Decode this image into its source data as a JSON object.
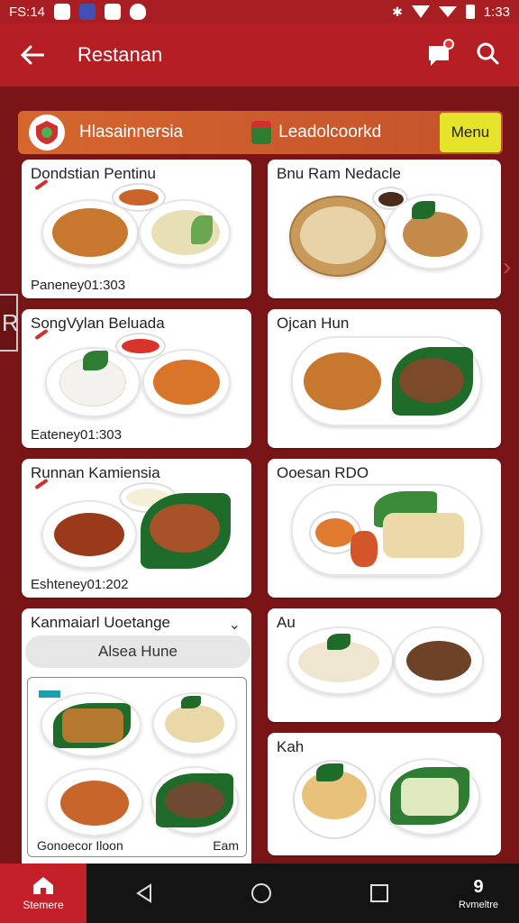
{
  "status_bar": {
    "time_left": "FS:14",
    "time_right": "1:33"
  },
  "app_bar": {
    "title": "Restanan"
  },
  "banner": {
    "brand_left": "Hlasainnersia",
    "brand_right": "Leadolcoorkd",
    "menu_label": "Menu"
  },
  "cards": {
    "c1": {
      "title": "Dondstian Pentinu",
      "price": "Paneney01:303"
    },
    "c2": {
      "title": "Bnu Ram Nedacle"
    },
    "c3": {
      "title": "SongVylan Beluada",
      "price": "Eateney01:303"
    },
    "c4": {
      "title": "Ojcan Hun"
    },
    "c5": {
      "title": "Runnan Kamiensia",
      "price": "Eshteney01:202"
    },
    "c6": {
      "title": "Ooesan RDO"
    },
    "c7": {
      "title": "Au"
    },
    "c8": {
      "title": "Kah"
    }
  },
  "expandable": {
    "title": "Kanmaiarl Uoetange",
    "search_label": "Alsea Hune",
    "footer_left": "Gonoecor Iloon",
    "footer_right": "Eam"
  },
  "nav": {
    "home_label": "Stemere",
    "right_label": "Rvmeltre",
    "right_glyph": "9"
  },
  "colors": {
    "primary": "#b51f24",
    "banner": "#d4662e",
    "menu_button": "#e6e42a"
  }
}
